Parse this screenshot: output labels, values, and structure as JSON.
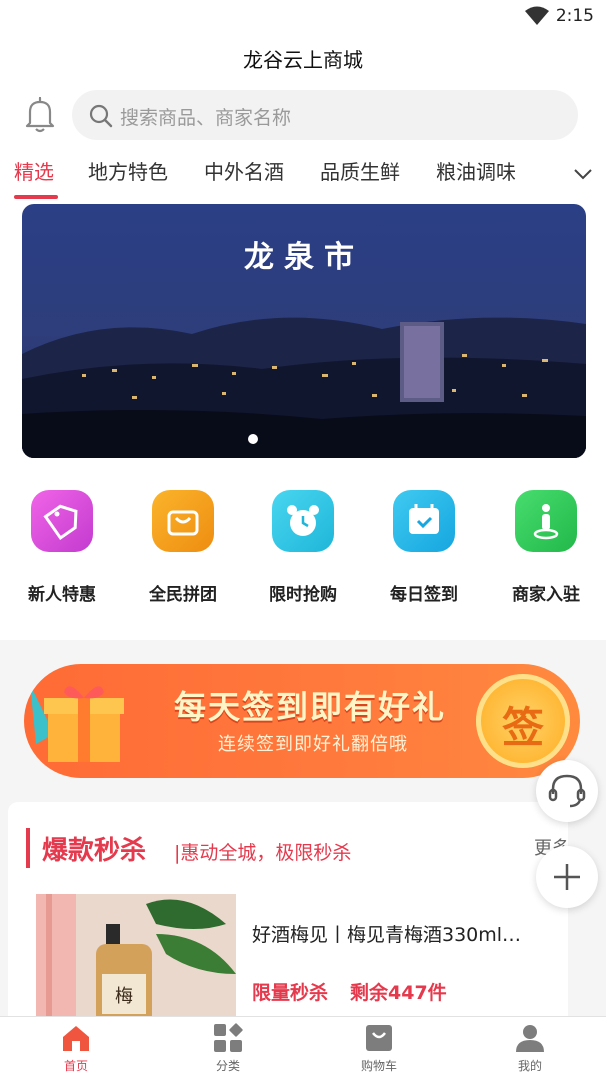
{
  "status": {
    "time": "2:15",
    "wifi_icon": "wifi-icon"
  },
  "header": {
    "title": "龙谷云上商城"
  },
  "search": {
    "placeholder": "搜索商品、商家名称"
  },
  "tabs": [
    {
      "label": "精选",
      "active": true
    },
    {
      "label": "地方特色"
    },
    {
      "label": "中外名酒"
    },
    {
      "label": "品质生鲜"
    },
    {
      "label": "粮油调味"
    }
  ],
  "banner": {
    "title": "龙泉市",
    "page_index": 1
  },
  "quick_links": [
    {
      "label": "新人特惠",
      "icon": "sale-tag-icon",
      "color": "#d94fd8"
    },
    {
      "label": "全民拼团",
      "icon": "shopping-bag-icon",
      "color": "#f6a21a"
    },
    {
      "label": "限时抢购",
      "icon": "alarm-clock-icon",
      "color": "#2fc6e3"
    },
    {
      "label": "每日签到",
      "icon": "calendar-check-icon",
      "color": "#23b6e6"
    },
    {
      "label": "商家入驻",
      "icon": "merchant-person-icon",
      "color": "#30c95a"
    }
  ],
  "promo": {
    "title": "每天签到即有好礼",
    "subtitle": "连续签到即好礼翻倍哦",
    "badge": "签"
  },
  "flash_sale": {
    "title": "爆款秒杀",
    "subtitle": "|惠动全城，极限秒杀",
    "more": "更多",
    "product": {
      "name": "好酒梅见丨梅见青梅酒330ml…",
      "tag": "限量秒杀",
      "stock": "剩余447件"
    }
  },
  "bottom_nav": [
    {
      "label": "首页",
      "icon": "home-icon",
      "active": true
    },
    {
      "label": "分类",
      "icon": "category-icon"
    },
    {
      "label": "购物车",
      "icon": "cart-icon"
    },
    {
      "label": "我的",
      "icon": "profile-icon"
    }
  ],
  "colors": {
    "accent": "#e53a4d",
    "promo": "#ff6b35"
  }
}
